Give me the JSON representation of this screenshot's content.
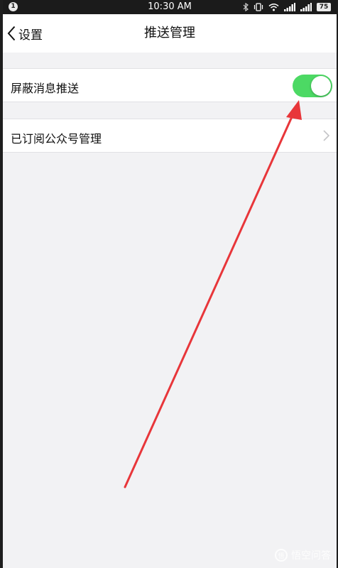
{
  "status_bar": {
    "notification_count": "1",
    "time": "10:30 AM",
    "icons": [
      "bluetooth-icon",
      "vibrate-icon",
      "wifi-icon",
      "signal-icon",
      "signal-icon"
    ],
    "battery": "75"
  },
  "nav": {
    "back_label": "设置",
    "title": "推送管理"
  },
  "settings": {
    "block_push": {
      "label": "屏蔽消息推送",
      "enabled": true
    },
    "subscriptions": {
      "label": "已订阅公众号管理"
    }
  },
  "annotation": {
    "color": "#e8363a"
  },
  "colors": {
    "toggle_on": "#4cd964",
    "background": "#f2f2f4"
  },
  "watermark": {
    "text": "悟空问答"
  }
}
